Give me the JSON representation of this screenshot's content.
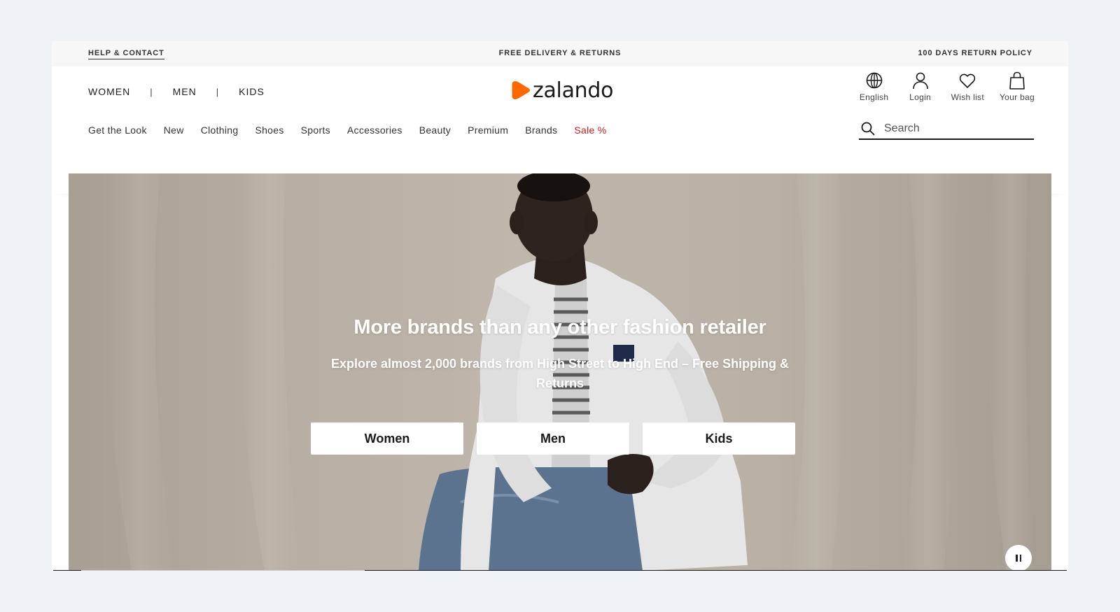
{
  "utility_bar": {
    "help": "HELP & CONTACT",
    "center": "FREE DELIVERY & RETURNS",
    "right": "100 DAYS RETURN POLICY"
  },
  "gender_nav": {
    "women": "WOMEN",
    "men": "MEN",
    "kids": "KIDS",
    "separator": "|"
  },
  "logo": {
    "text": "zalando",
    "brand_color": "#ff6900"
  },
  "actions": {
    "language": {
      "label": "English",
      "icon": "globe-icon"
    },
    "login": {
      "label": "Login",
      "icon": "user-icon"
    },
    "wishlist": {
      "label": "Wish list",
      "icon": "heart-icon"
    },
    "bag": {
      "label": "Your bag",
      "icon": "bag-icon"
    }
  },
  "category_nav": {
    "items": [
      "Get the Look",
      "New",
      "Clothing",
      "Shoes",
      "Sports",
      "Accessories",
      "Beauty",
      "Premium",
      "Brands"
    ],
    "sale": "Sale %",
    "sale_color": "#d0191c"
  },
  "search": {
    "placeholder": "Search",
    "value": ""
  },
  "hero": {
    "title": "More brands than any other fashion retailer",
    "subtitle": "Explore almost 2,000 brands from High Street to High End – Free Shipping & Returns",
    "buttons": {
      "women": "Women",
      "men": "Men",
      "kids": "Kids"
    },
    "pause_icon": "pause-icon",
    "progress": 0.28
  }
}
